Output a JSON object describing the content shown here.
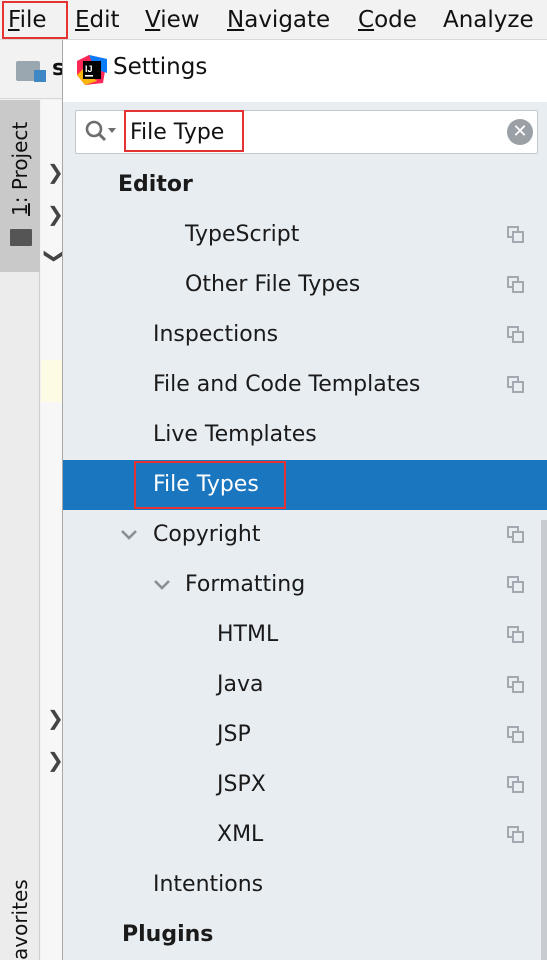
{
  "menubar": {
    "items": [
      {
        "underline": "F",
        "rest": "ile"
      },
      {
        "underline": "E",
        "rest": "dit"
      },
      {
        "underline": "V",
        "rest": "iew"
      },
      {
        "underline": "N",
        "rest": "avigate"
      },
      {
        "underline": "C",
        "rest": "ode"
      },
      {
        "underline": "",
        "rest": "Analyze"
      }
    ]
  },
  "ide": {
    "toolbar_text": "s",
    "project_tool": {
      "underline": "1",
      "rest": ": Project"
    },
    "favorites_tool": "avorites"
  },
  "dialog": {
    "title": "Settings",
    "search": {
      "value": "File Type"
    },
    "tree": [
      {
        "label": "Editor",
        "bold": true,
        "copy": false
      },
      {
        "label": "TypeScript",
        "copy": true
      },
      {
        "label": "Other File Types",
        "copy": true
      },
      {
        "label": "Inspections",
        "copy": true
      },
      {
        "label": "File and Code Templates",
        "copy": true
      },
      {
        "label": "Live Templates",
        "copy": false
      },
      {
        "label": "File Types",
        "selected": true,
        "copy": false
      },
      {
        "label": "Copyright",
        "expanded": true,
        "copy": true
      },
      {
        "label": "Formatting",
        "expanded": true,
        "copy": true
      },
      {
        "label": "HTML",
        "copy": true
      },
      {
        "label": "Java",
        "copy": true
      },
      {
        "label": "JSP",
        "copy": true
      },
      {
        "label": "JSPX",
        "copy": true
      },
      {
        "label": "XML",
        "copy": true
      },
      {
        "label": "Intentions",
        "copy": false
      },
      {
        "label": "Plugins",
        "bold": true,
        "copy": false
      }
    ]
  },
  "icons": {
    "app_logo": "intellij-logo-icon",
    "search": "search-icon",
    "clear": "clear-icon",
    "copy": "project-scope-copy-icon",
    "chevron": "chevron-down-icon",
    "folder": "folder-icon"
  },
  "colors": {
    "selection": "#1b76c0",
    "highlight_box": "#e53333",
    "dialog_bg": "#e8edf2"
  }
}
